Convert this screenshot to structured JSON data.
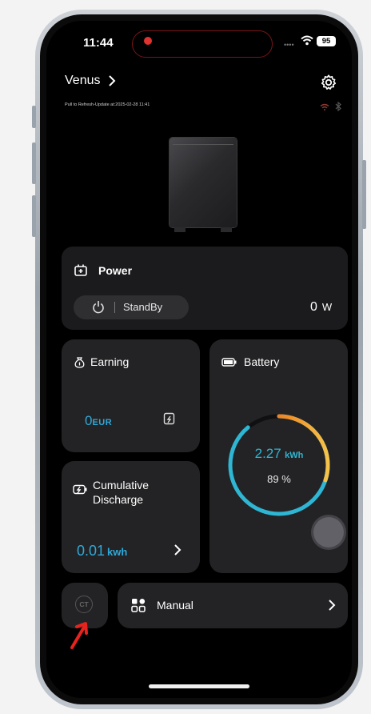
{
  "status_bar": {
    "time": "11:44",
    "battery_level": "95"
  },
  "header": {
    "device_name": "Venus",
    "subtitle": "Pull to Refresh-Update at:2025-02-28 11:41"
  },
  "power_card": {
    "title": "Power",
    "mode": "StandBy",
    "value": "0",
    "unit": "W"
  },
  "earning_card": {
    "title": "Earning",
    "value": "0",
    "unit": "EUR"
  },
  "cumulative_card": {
    "title_line1": "Cumulative",
    "title_line2": "Discharge",
    "value": "0.01",
    "unit": "kwh"
  },
  "battery_card": {
    "title": "Battery",
    "energy_value": "2.27",
    "energy_unit": "kWh",
    "soc": "89 %",
    "soc_fraction": 0.89
  },
  "ct_button": {
    "label": "CT"
  },
  "manual_card": {
    "label": "Manual"
  },
  "colors": {
    "ring_teal": "#2fb6d3",
    "ring_orange": "#f08a24",
    "ring_red": "#e53a32",
    "value_blue": "#2fa8d8",
    "annotation_red": "#e8231d"
  }
}
